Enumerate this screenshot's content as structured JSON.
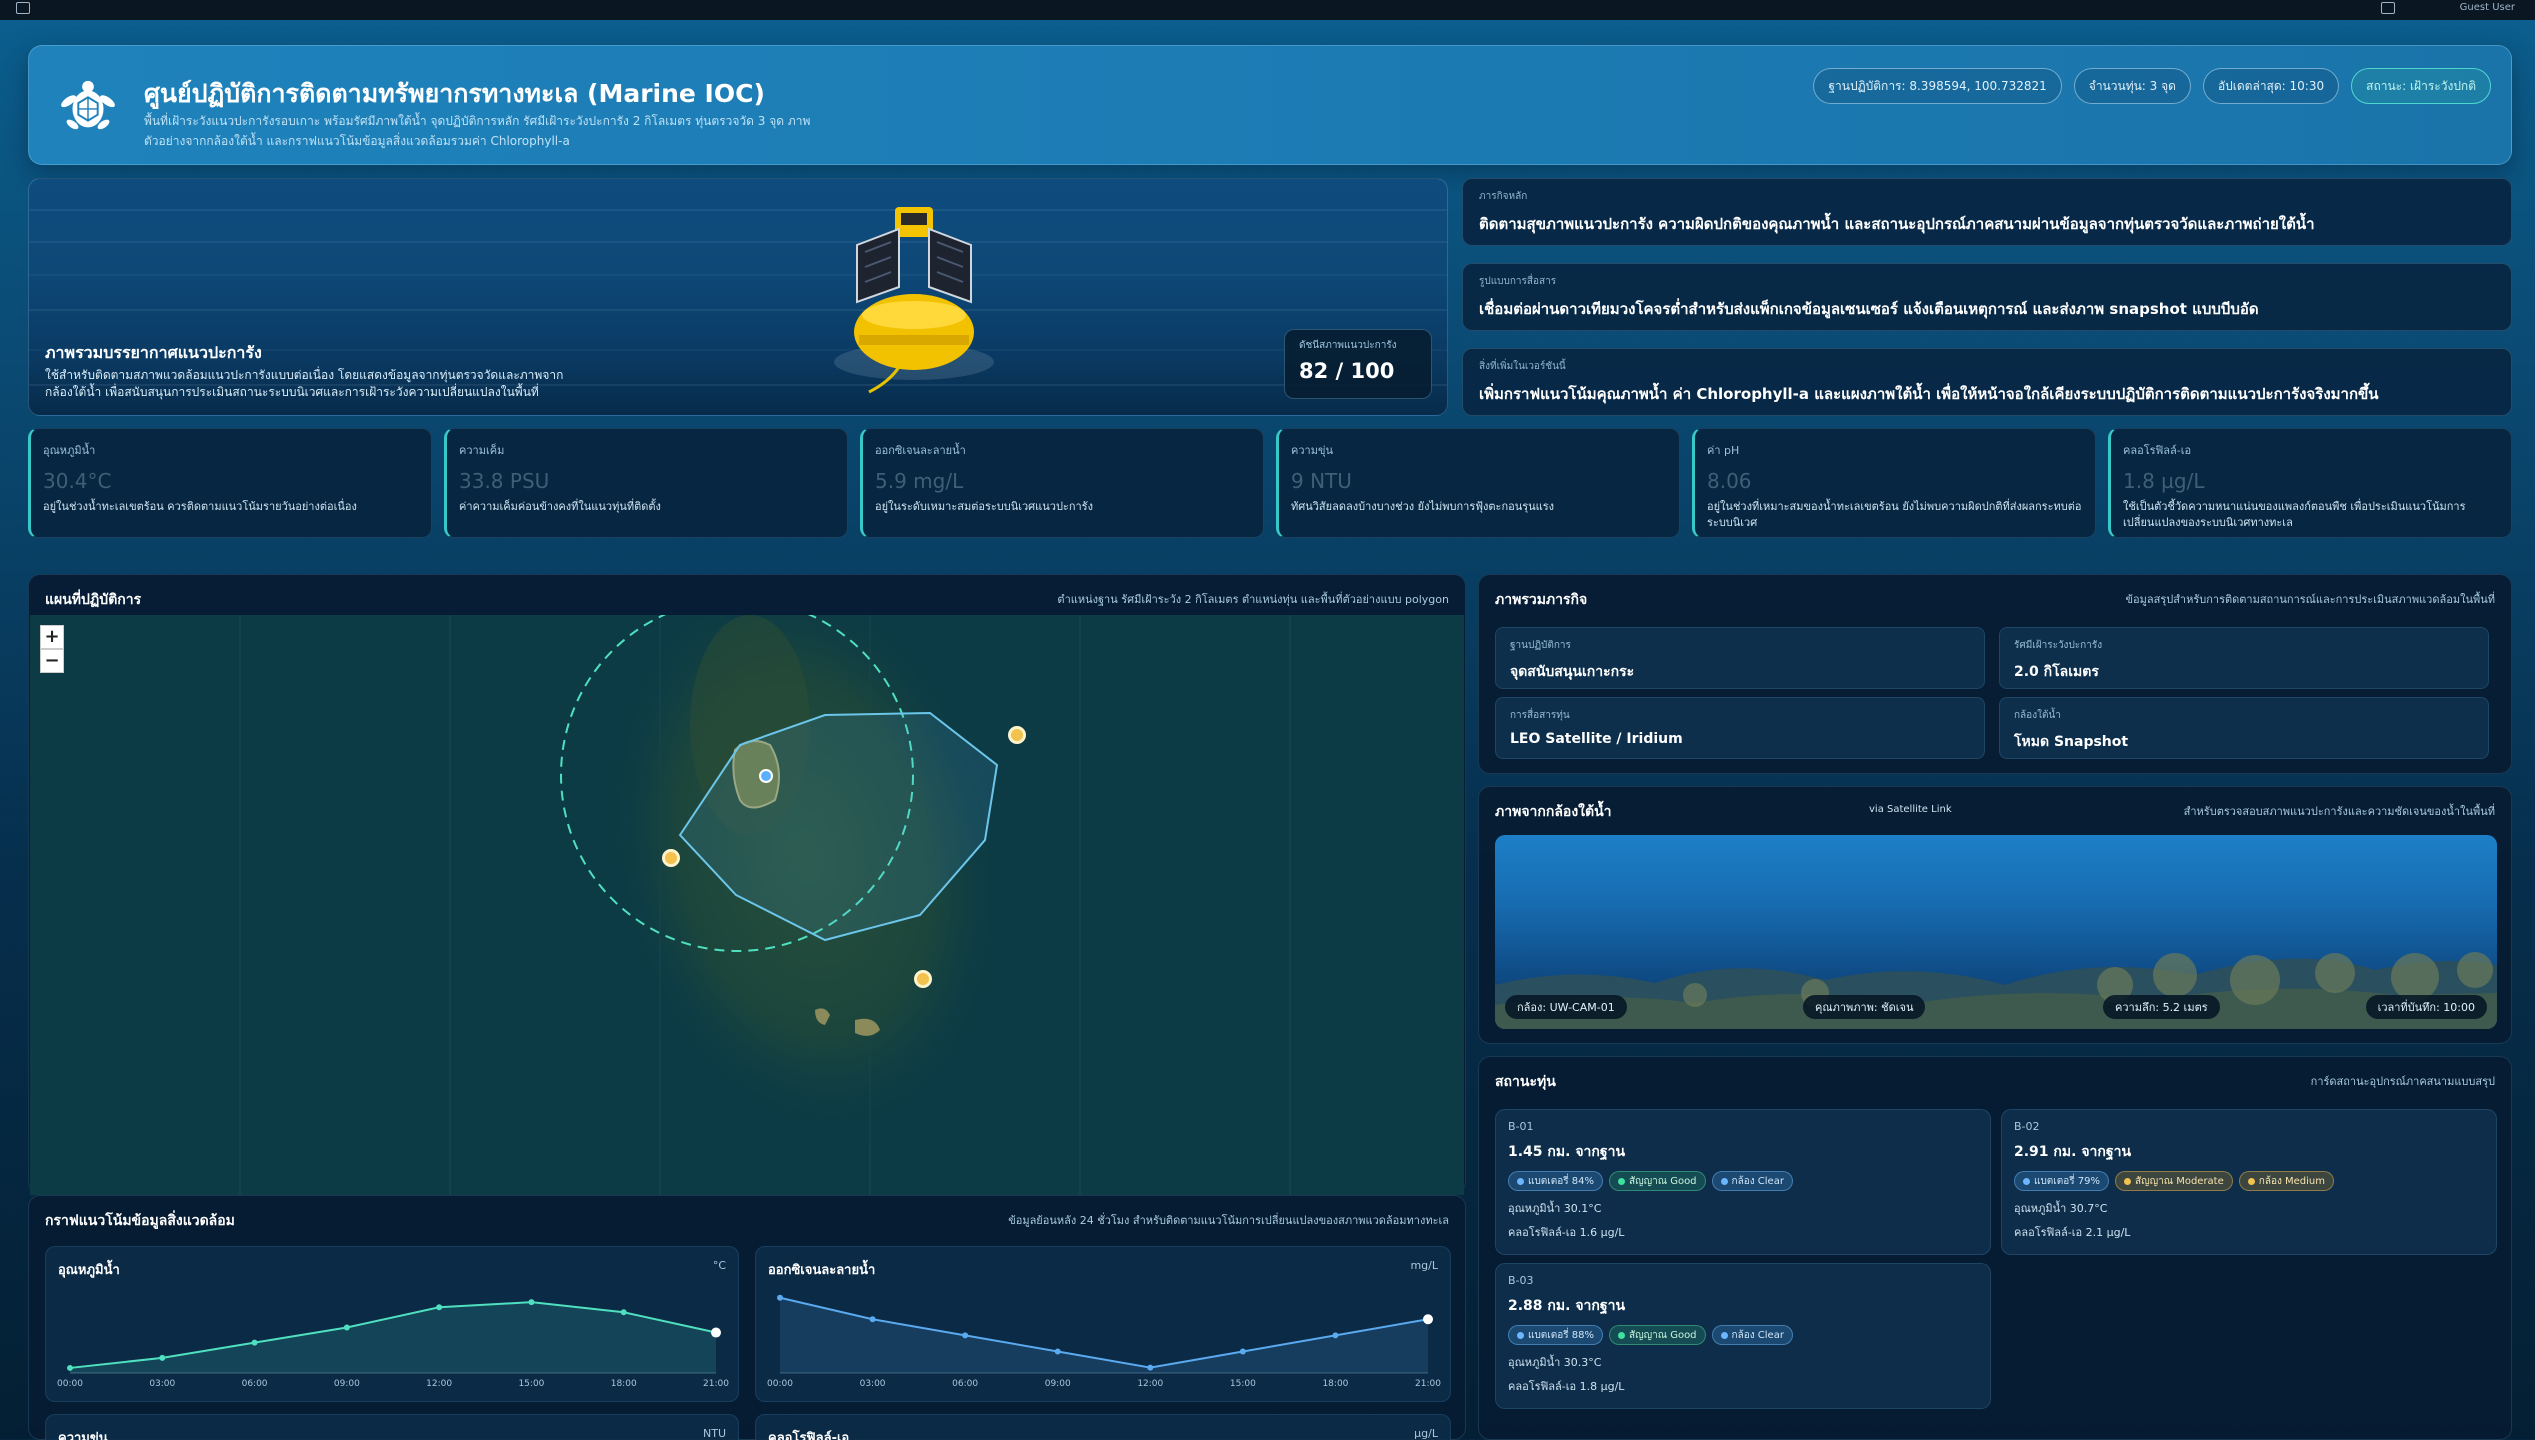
{
  "header": {
    "title": "ศูนย์ปฏิบัติการติดตามทรัพยากรทางทะเล (Marine IOC)",
    "subtitle": "พื้นที่เฝ้าระวังแนวปะการังรอบเกาะ พร้อมรัศมีภาพใต้น้ำ จุดปฏิบัติการหลัก รัศมีเฝ้าระวังปะการัง 2 กิโลเมตร ทุ่นตรวจวัด 3 จุด ภาพตัวอย่างจากกล้องใต้น้ำ และกราฟแนวโน้มข้อมูลสิ่งแวดล้อมรวมค่า Chlorophyll-a",
    "pills": {
      "base": "ฐานปฏิบัติการ: 8.398594, 100.732821",
      "buoys": "จำนวนทุ่น: 3 จุด",
      "updated": "อัปเดตล่าสุด: 10:30",
      "status": "สถานะ: เฝ้าระวังปกติ"
    }
  },
  "topbar": {
    "user": "Guest User"
  },
  "hero": {
    "title": "ภาพรวมบรรยากาศแนวปะการัง",
    "desc": "ใช้สำหรับติดตามสภาพแวดล้อมแนวปะการังแบบต่อเนื่อง โดยแสดงข้อมูลจากทุ่นตรวจวัดและภาพจากกล้องใต้น้ำ เพื่อสนับสนุนการประเมินสถานะระบบนิเวศและการเฝ้าระวังความเปลี่ยนแปลงในพื้นที่",
    "score_label": "ดัชนีสภาพแนวปะการัง",
    "score_value": "82 / 100"
  },
  "mission": [
    {
      "label": "ภารกิจหลัก",
      "text": "ติดตามสุขภาพแนวปะการัง ความผิดปกติของคุณภาพน้ำ และสถานะอุปกรณ์ภาคสนามผ่านข้อมูลจากทุ่นตรวจวัดและภาพถ่ายใต้น้ำ"
    },
    {
      "label": "รูปแบบการสื่อสาร",
      "text": "เชื่อมต่อผ่านดาวเทียมวงโคจรต่ำสำหรับส่งแพ็กเกจข้อมูลเซนเซอร์ แจ้งเตือนเหตุการณ์ และส่งภาพ snapshot แบบบีบอัด"
    },
    {
      "label": "สิ่งที่เพิ่มในเวอร์ชันนี้",
      "text": "เพิ่มกราฟแนวโน้มคุณภาพน้ำ ค่า Chlorophyll-a และแผงภาพใต้น้ำ เพื่อให้หน้าจอใกล้เคียงระบบปฏิบัติการติดตามแนวปะการังจริงมากขึ้น"
    }
  ],
  "metrics": [
    {
      "label": "อุณหภูมิน้ำ",
      "value": "30.4°C",
      "note": "อยู่ในช่วงน้ำทะเลเขตร้อน ควรติดตามแนวโน้มรายวันอย่างต่อเนื่อง"
    },
    {
      "label": "ความเค็ม",
      "value": "33.8 PSU",
      "note": "ค่าความเค็มค่อนข้างคงที่ในแนวทุ่นที่ติดตั้ง"
    },
    {
      "label": "ออกซิเจนละลายน้ำ",
      "value": "5.9 mg/L",
      "note": "อยู่ในระดับเหมาะสมต่อระบบนิเวศแนวปะการัง"
    },
    {
      "label": "ความขุ่น",
      "value": "9 NTU",
      "note": "ทัศนวิสัยลดลงบ้างบางช่วง ยังไม่พบการฟุ้งตะกอนรุนแรง"
    },
    {
      "label": "ค่า pH",
      "value": "8.06",
      "note": "อยู่ในช่วงที่เหมาะสมของน้ำทะเลเขตร้อน ยังไม่พบความผิดปกติที่ส่งผลกระทบต่อระบบนิเวศ"
    },
    {
      "label": "คลอโรฟิลล์-เอ",
      "value": "1.8 µg/L",
      "note": "ใช้เป็นตัวชี้วัดความหนาแน่นของแพลงก์ตอนพืช เพื่อประเมินแนวโน้มการเปลี่ยนแปลงของระบบนิเวศทางทะเล"
    }
  ],
  "map": {
    "title": "แผนที่ปฏิบัติการ",
    "note": "ตำแหน่งฐาน รัศมีเฝ้าระวัง 2 กิโลเมตร ตำแหน่งทุ่น และพื้นที่ตัวอย่างแบบ polygon",
    "zoom_in": "+",
    "zoom_out": "−"
  },
  "overview": {
    "title": "ภาพรวมภารกิจ",
    "note": "ข้อมูลสรุปสำหรับการติดตามสถานการณ์และการประเมินสภาพแวดล้อมในพื้นที่",
    "cells": [
      {
        "label": "ฐานปฏิบัติการ",
        "value": "จุดสนับสนุนเกาะกระ"
      },
      {
        "label": "รัศมีเฝ้าระวังปะการัง",
        "value": "2.0 กิโลเมตร"
      },
      {
        "label": "การสื่อสารทุ่น",
        "value": "LEO Satellite / Iridium"
      },
      {
        "label": "กล้องใต้น้ำ",
        "value": "โหมด Snapshot"
      }
    ]
  },
  "camera": {
    "title": "ภาพจากกล้องใต้น้ำ",
    "link": "via Satellite Link",
    "note": "สำหรับตรวจสอบสภาพแนวปะการังและความชัดเจนของน้ำในพื้นที่",
    "tags": [
      "กล้อง: UW-CAM-01",
      "คุณภาพภาพ: ชัดเจน",
      "ความลึก: 5.2 เมตร",
      "เวลาที่บันทึก: 10:00"
    ]
  },
  "buoys": {
    "title": "สถานะทุ่น",
    "note": "การ์ดสถานะอุปกรณ์ภาคสนามแบบสรุป",
    "items": [
      {
        "id": "B-01",
        "distance": "1.45 กม. จากฐาน",
        "battery": "แบตเตอรี่ 84%",
        "signal": "สัญญาณ Good",
        "camera": "กล้อง Clear",
        "temp": "อุณหภูมิน้ำ 30.1°C",
        "chl": "คลอโรฟิลล์-เอ 1.6 µg/L"
      },
      {
        "id": "B-02",
        "distance": "2.91 กม. จากฐาน",
        "battery": "แบตเตอรี่ 79%",
        "signal": "สัญญาณ Moderate",
        "camera": "กล้อง Medium",
        "temp": "อุณหภูมิน้ำ 30.7°C",
        "chl": "คลอโรฟิลล์-เอ 2.1 µg/L"
      },
      {
        "id": "B-03",
        "distance": "2.88 กม. จากฐาน",
        "battery": "แบตเตอรี่ 88%",
        "signal": "สัญญาณ Good",
        "camera": "กล้อง Clear",
        "temp": "อุณหภูมิน้ำ 30.3°C",
        "chl": "คลอโรฟิลล์-เอ 1.8 µg/L"
      }
    ]
  },
  "trends": {
    "title": "กราฟแนวโน้มข้อมูลสิ่งแวดล้อม",
    "note": "ข้อมูลย้อนหลัง 24 ชั่วโมง สำหรับติดตามแนวโน้มการเปลี่ยนแปลงของสภาพแวดล้อมทางทะเล",
    "charts": [
      {
        "title": "อุณหภูมิน้ำ",
        "unit": "°C"
      },
      {
        "title": "ออกซิเจนละลายน้ำ",
        "unit": "mg/L"
      },
      {
        "title": "ความขุ่น",
        "unit": "NTU"
      },
      {
        "title": "คลอโรฟิลล์-เอ",
        "unit": "µg/L"
      }
    ]
  },
  "chart_data": [
    {
      "type": "area",
      "title": "อุณหภูมิน้ำ",
      "ylabel": "°C",
      "x": [
        "00:00",
        "03:00",
        "06:00",
        "09:00",
        "12:00",
        "15:00",
        "18:00",
        "21:00"
      ],
      "values": [
        29.4,
        29.6,
        29.9,
        30.2,
        30.6,
        30.7,
        30.5,
        30.1
      ],
      "ylim": [
        29.3,
        31.0
      ],
      "color": "#4fe0c0"
    },
    {
      "type": "area",
      "title": "ออกซิเจนละลายน้ำ",
      "ylabel": "mg/L",
      "x": [
        "00:00",
        "03:00",
        "06:00",
        "09:00",
        "12:00",
        "15:00",
        "18:00",
        "21:00"
      ],
      "values": [
        6.3,
        6.1,
        5.95,
        5.8,
        5.65,
        5.8,
        5.95,
        6.1
      ],
      "ylim": [
        5.6,
        6.4
      ],
      "color": "#5aaaf0"
    }
  ],
  "colors": {
    "accent": "#38c8c8",
    "brand": "#1f82bb",
    "buoy_marker": "#f2c14e",
    "base_marker": "#5ab0ff"
  }
}
